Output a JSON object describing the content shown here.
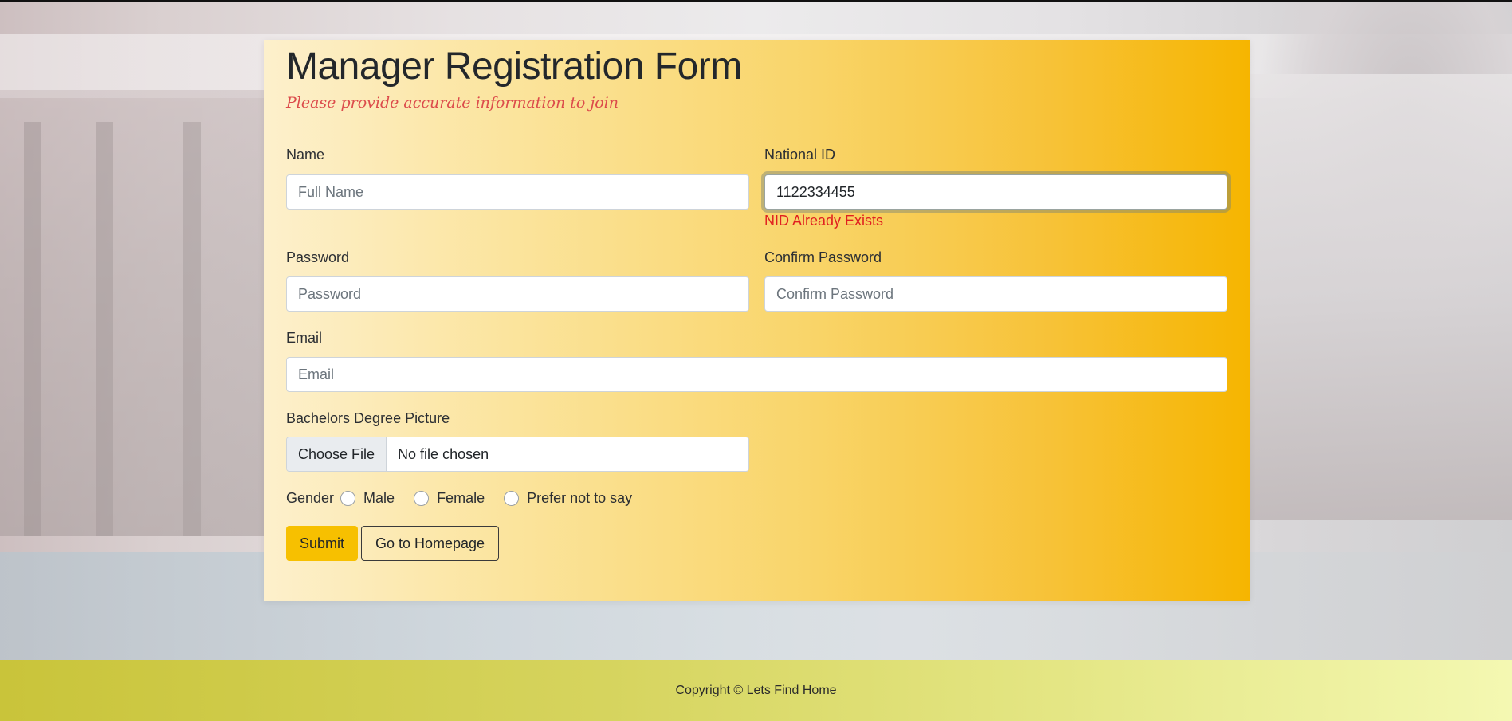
{
  "form": {
    "title": "Manager Registration Form",
    "subtitle": "Please provide accurate information to join",
    "name": {
      "label": "Name",
      "placeholder": "Full Name",
      "value": ""
    },
    "nid": {
      "label": "National ID",
      "placeholder": "",
      "value": "1122334455",
      "error": "NID Already Exists"
    },
    "password": {
      "label": "Password",
      "placeholder": "Password"
    },
    "confirm_password": {
      "label": "Confirm Password",
      "placeholder": "Confirm Password"
    },
    "email": {
      "label": "Email",
      "placeholder": "Email"
    },
    "degree": {
      "label": "Bachelors Degree Picture",
      "choose_label": "Choose File",
      "file_status": "No file chosen"
    },
    "gender": {
      "label": "Gender",
      "options": [
        "Male",
        "Female",
        "Prefer not to say"
      ]
    },
    "submit_label": "Submit",
    "home_label": "Go to Homepage"
  },
  "footer": {
    "text": "Copyright © Lets Find Home"
  },
  "colors": {
    "card_gradient_start": "#fdf0cc",
    "card_gradient_end": "#f6b500",
    "submit": "#f7c000",
    "error": "#e02020",
    "subtitle": "#dc4b4b",
    "footer_start": "#c9c43a",
    "footer_end": "#f4f8b2"
  }
}
